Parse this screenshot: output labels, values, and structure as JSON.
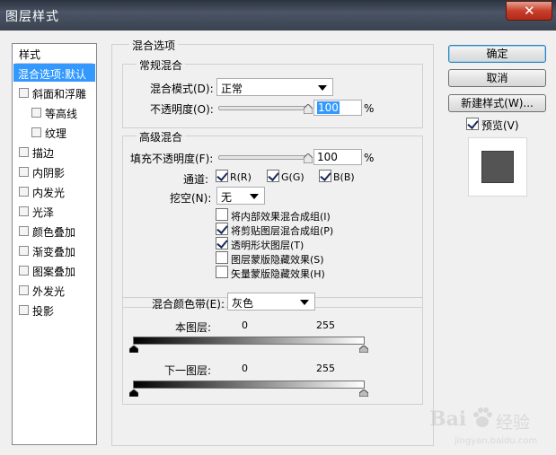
{
  "window": {
    "title": "图层样式",
    "close_glyph": "✕"
  },
  "styles_list": {
    "header": "样式",
    "items": [
      {
        "label": "混合选项:默认",
        "checkbox": false,
        "selected": true
      },
      {
        "label": "斜面和浮雕",
        "checkbox": true,
        "checked": false
      },
      {
        "label": "等高线",
        "checkbox": true,
        "checked": false,
        "indent": true
      },
      {
        "label": "纹理",
        "checkbox": true,
        "checked": false,
        "indent": true
      },
      {
        "label": "描边",
        "checkbox": true,
        "checked": false
      },
      {
        "label": "内阴影",
        "checkbox": true,
        "checked": false
      },
      {
        "label": "内发光",
        "checkbox": true,
        "checked": false
      },
      {
        "label": "光泽",
        "checkbox": true,
        "checked": false
      },
      {
        "label": "颜色叠加",
        "checkbox": true,
        "checked": false
      },
      {
        "label": "渐变叠加",
        "checkbox": true,
        "checked": false
      },
      {
        "label": "图案叠加",
        "checkbox": true,
        "checked": false
      },
      {
        "label": "外发光",
        "checkbox": true,
        "checked": false
      },
      {
        "label": "投影",
        "checkbox": true,
        "checked": false
      }
    ]
  },
  "blend_options": {
    "group_label": "混合选项",
    "general": {
      "group_label": "常规混合",
      "blend_mode_label": "混合模式(D):",
      "blend_mode_value": "正常",
      "opacity_label": "不透明度(O):",
      "opacity_value": "100",
      "opacity_percent": 100,
      "unit": "%"
    },
    "advanced": {
      "group_label": "高级混合",
      "fill_opacity_label": "填充不透明度(F):",
      "fill_opacity_value": "100",
      "fill_opacity_percent": 100,
      "unit": "%",
      "channels_label": "通道:",
      "channels": [
        {
          "label": "R(R)",
          "checked": true
        },
        {
          "label": "G(G)",
          "checked": true
        },
        {
          "label": "B(B)",
          "checked": true
        }
      ],
      "knockout_label": "挖空(N):",
      "knockout_value": "无",
      "options": [
        {
          "label": "将内部效果混合成组(I)",
          "checked": false
        },
        {
          "label": "将剪贴图层混合成组(P)",
          "checked": true
        },
        {
          "label": "透明形状图层(T)",
          "checked": true
        },
        {
          "label": "图层蒙版隐藏效果(S)",
          "checked": false
        },
        {
          "label": "矢量蒙版隐藏效果(H)",
          "checked": false
        }
      ]
    },
    "blend_if": {
      "label": "混合颜色带(E):",
      "value": "灰色",
      "this_layer": {
        "label": "本图层:",
        "min": "0",
        "max": "255"
      },
      "underlying_layer": {
        "label": "下一图层:",
        "min": "0",
        "max": "255"
      }
    }
  },
  "buttons": {
    "ok": "确定",
    "cancel": "取消",
    "new_style": "新建样式(W)...",
    "preview_label": "预览(V)",
    "preview_checked": true
  },
  "watermark": {
    "text": "Bai",
    "brand": "经验",
    "domain": "jingyan.baidu.com"
  },
  "colors": {
    "selection": "#3399ff",
    "titlebar": "#3a4250",
    "close": "#c8402c"
  }
}
